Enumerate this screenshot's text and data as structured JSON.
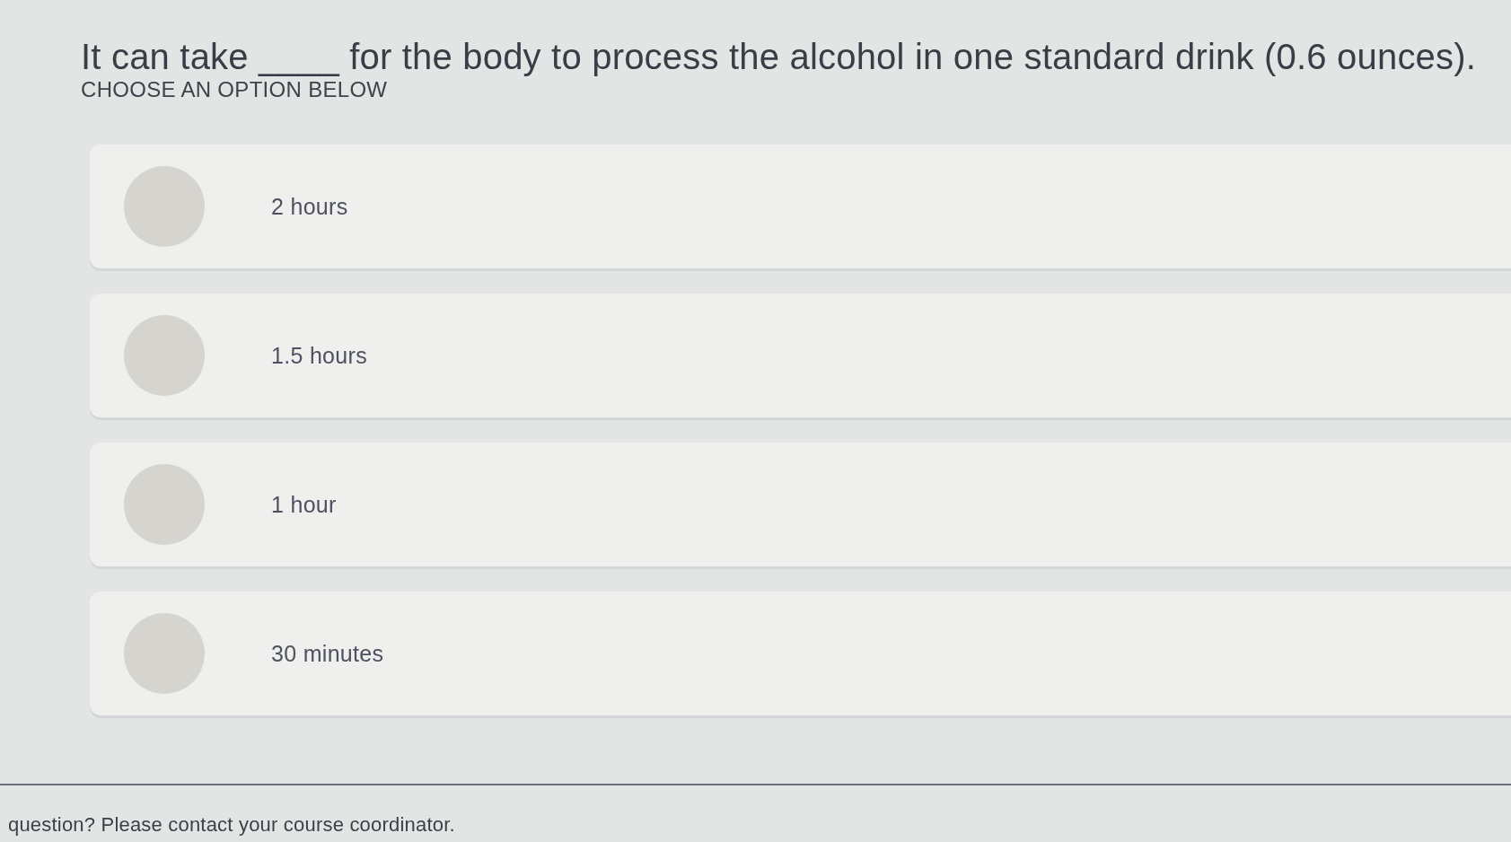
{
  "question": {
    "text": "It can take ____ for the body to process the alcohol in one standard drink (0.6 ounces).",
    "instruction": "CHOOSE AN OPTION BELOW"
  },
  "options": [
    {
      "label": "2 hours",
      "selected": false
    },
    {
      "label": "1.5 hours",
      "selected": false
    },
    {
      "label": "1 hour",
      "selected": false
    },
    {
      "label": "30 minutes",
      "selected": false
    }
  ],
  "footer": {
    "text": "question? Please contact your course coordinator."
  }
}
